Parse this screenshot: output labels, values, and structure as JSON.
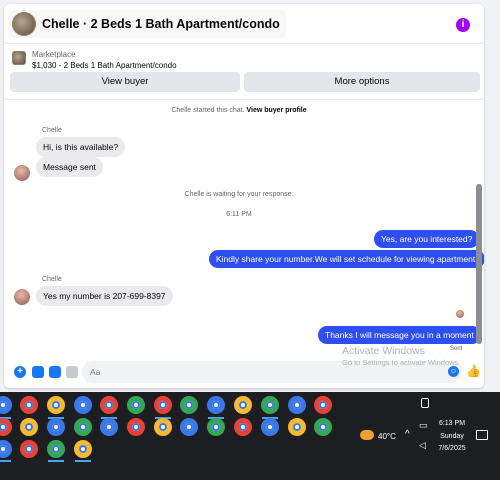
{
  "header": {
    "title": "Chelle · 2 Beds 1 Bath Apartment/condo",
    "thumb_icon": "listing-thumbnail",
    "info_icon": "info-icon",
    "accent": "#a100ff"
  },
  "marketplace": {
    "label": "Marketplace",
    "item": "$1,030 - 2 Beds 1 Bath Apartment/condo",
    "view_buyer": "View buyer",
    "more_options": "More options"
  },
  "messages": {
    "started": "Chelle started this chat.",
    "view_profile": "View buyer profile",
    "sender1": "Chelle",
    "in1": "Hi, is this available?",
    "in2": "Message sent",
    "waiting": "Chelle is waiting for your response.",
    "time": "6:11 PM",
    "out1": "Yes, are you interested?",
    "out2": "Kindly share your number.We will set schedule for viewing apartment.",
    "sender2": "Chelle",
    "in3": "Yes my number is 207-699-8397",
    "out3": "Thanks I will message you in a moment",
    "sent": "Sent",
    "outgoing_color": "#2d4ff0"
  },
  "composer": {
    "placeholder": "Aa"
  },
  "watermark": {
    "line1": "Activate Windows",
    "line2": "Go to Settings to activate Windows."
  },
  "taskbar": {
    "weather": "40°C",
    "time": "6:13 PM",
    "day": "Sunday",
    "date": "7/6/2025"
  }
}
